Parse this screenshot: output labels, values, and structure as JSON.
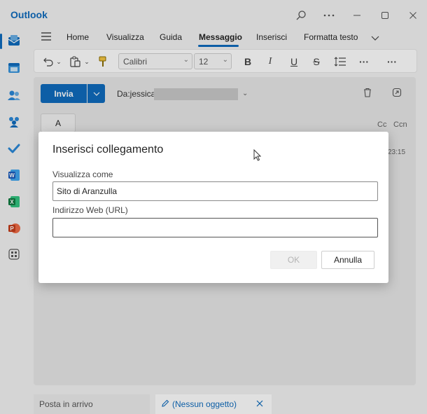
{
  "app": {
    "title": "Outlook"
  },
  "titlebar": {
    "search_icon": "search-icon",
    "more_icon": "more-icon",
    "minimize_icon": "minimize-icon",
    "maximize_icon": "maximize-icon",
    "close_icon": "close-icon"
  },
  "rail": {
    "items": [
      {
        "icon": "mail-icon",
        "active": true
      },
      {
        "icon": "calendar-icon"
      },
      {
        "icon": "people-icon"
      },
      {
        "icon": "groups-icon"
      },
      {
        "icon": "todo-icon"
      },
      {
        "icon": "word-icon"
      },
      {
        "icon": "excel-icon"
      },
      {
        "icon": "powerpoint-icon"
      },
      {
        "icon": "apps-icon"
      }
    ]
  },
  "ribbon": {
    "tabs": [
      {
        "label": "Home"
      },
      {
        "label": "Visualizza"
      },
      {
        "label": "Guida"
      },
      {
        "label": "Messaggio",
        "active": true
      },
      {
        "label": "Inserisci"
      },
      {
        "label": "Formatta testo"
      }
    ]
  },
  "toolbar": {
    "font": "Calibri",
    "size": "12",
    "bold": "B",
    "italic": "I",
    "underline": "U",
    "strike": "S",
    "more": "···"
  },
  "compose": {
    "send_label": "Invia",
    "from_label": "Da:jessica.",
    "to_label": "A",
    "cc_label": "Cc",
    "bcc_label": "Ccn",
    "time": "23:15"
  },
  "bottom_tabs": {
    "inbox": "Posta in arrivo",
    "draft": "(Nessun oggetto)"
  },
  "dialog": {
    "title": "Inserisci collegamento",
    "display_label": "Visualizza come",
    "display_value": "Sito di Aranzulla",
    "url_label": "Indirizzo Web (URL)",
    "url_value": "",
    "ok_label": "OK",
    "cancel_label": "Annulla"
  },
  "colors": {
    "accent": "#0f6cbd",
    "send_button": "#0f6cbd",
    "ok_disabled_text": "#b5b5b5"
  }
}
